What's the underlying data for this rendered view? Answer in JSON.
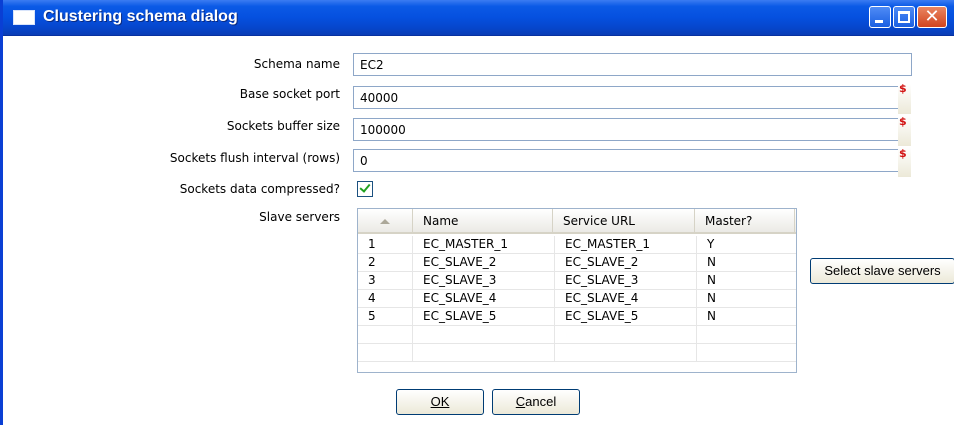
{
  "window": {
    "title": "Clustering schema dialog"
  },
  "form": {
    "schema_name": {
      "label": "Schema name",
      "value": "EC2"
    },
    "base_socket_port": {
      "label": "Base socket port",
      "value": "40000",
      "variable_marker": "$"
    },
    "sockets_buffer_size": {
      "label": "Sockets buffer size",
      "value": "100000",
      "variable_marker": "$"
    },
    "sockets_flush_interval": {
      "label": "Sockets flush interval (rows)",
      "value": "0",
      "variable_marker": "$"
    },
    "sockets_compressed": {
      "label": "Sockets data compressed?",
      "checked": true
    },
    "slave_servers_label": "Slave servers"
  },
  "slave_table": {
    "columns": [
      "Name",
      "Service URL",
      "Master?"
    ],
    "rows": [
      {
        "num": "1",
        "name": "EC_MASTER_1",
        "url": "EC_MASTER_1",
        "master": "Y"
      },
      {
        "num": "2",
        "name": "EC_SLAVE_2",
        "url": "EC_SLAVE_2",
        "master": "N"
      },
      {
        "num": "3",
        "name": "EC_SLAVE_3",
        "url": "EC_SLAVE_3",
        "master": "N"
      },
      {
        "num": "4",
        "name": "EC_SLAVE_4",
        "url": "EC_SLAVE_4",
        "master": "N"
      },
      {
        "num": "5",
        "name": "EC_SLAVE_5",
        "url": "EC_SLAVE_5",
        "master": "N"
      }
    ]
  },
  "buttons": {
    "select_slave_servers": "Select slave servers",
    "ok": "OK",
    "cancel": "Cancel"
  },
  "colors": {
    "titlebar": "#0550df",
    "variable_marker": "#d21010",
    "check": "#21a121"
  }
}
